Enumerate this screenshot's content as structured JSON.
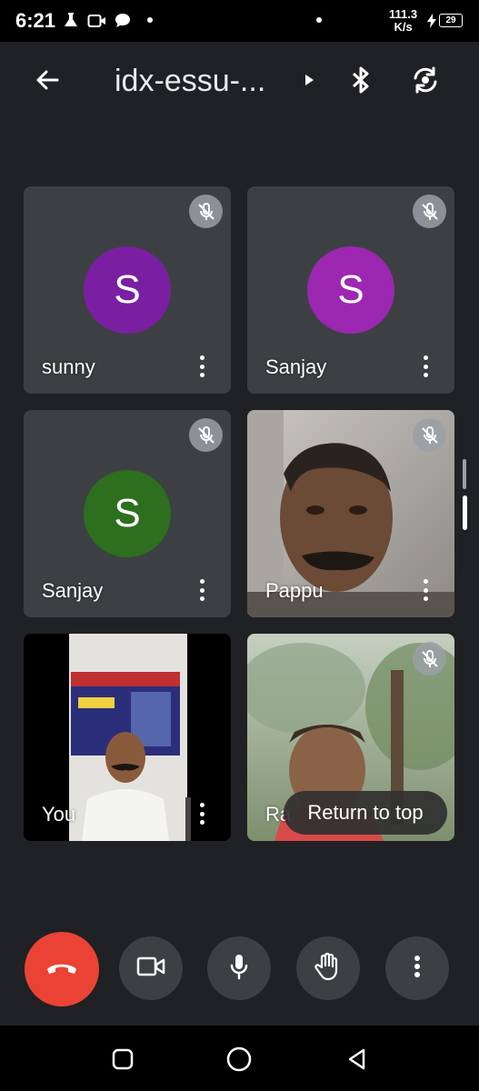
{
  "status_bar": {
    "time": "6:21",
    "net_speed_value": "111.3",
    "net_speed_unit": "K/s",
    "battery": "29"
  },
  "header": {
    "meeting_title": "idx-essu-...",
    "icons": [
      "back-arrow-icon",
      "expand-arrow-icon",
      "bluetooth-icon",
      "switch-camera-icon"
    ]
  },
  "participants": [
    {
      "name": "sunny",
      "initial": "S",
      "avatar_color": "#7b1fa2",
      "muted": true,
      "has_video": false
    },
    {
      "name": "Sanjay",
      "initial": "S",
      "avatar_color": "#9c27b0",
      "muted": true,
      "has_video": false
    },
    {
      "name": "Sanjay",
      "initial": "S",
      "avatar_color": "#2e6e1f",
      "muted": true,
      "has_video": false
    },
    {
      "name": "Pappu",
      "muted": true,
      "has_video": true
    },
    {
      "name": "You",
      "muted": false,
      "has_video": true
    },
    {
      "name": "Ra",
      "muted": true,
      "has_video": true
    }
  ],
  "return_to_top_label": "Return to top",
  "controls": [
    "end-call-icon",
    "camera-icon",
    "microphone-icon",
    "raise-hand-icon",
    "more-vert-icon"
  ],
  "colors": {
    "background": "#202124",
    "tile": "#3c4043",
    "end_call": "#ea4335",
    "mute_badge": "#9aa0a6"
  }
}
